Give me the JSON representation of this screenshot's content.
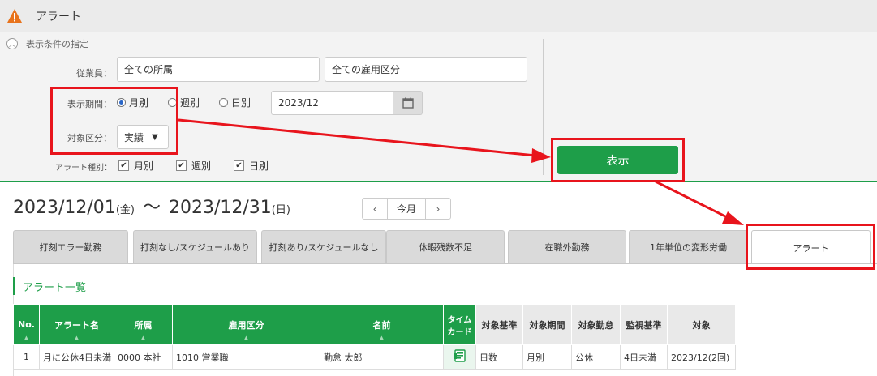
{
  "app": {
    "title": "アラート"
  },
  "conditions": {
    "header": "表示条件の指定",
    "employee_label": "従業員：",
    "department_value": "全ての所属",
    "employment_value": "全ての雇用区分",
    "period_label": "表示期間：",
    "period_options": [
      "月別",
      "週別",
      "日別"
    ],
    "period_selected": "月別",
    "month_value": "2023/12",
    "target_label": "対象区分：",
    "target_value": "実績",
    "alert_type_label": "アラート種別：",
    "alert_types": [
      "月別",
      "週別",
      "日別"
    ],
    "show_button": "表示"
  },
  "range": {
    "start": "2023/12/01",
    "start_dow": "(金)",
    "sep": "～",
    "end": "2023/12/31",
    "end_dow": "(日)",
    "today_label": "今月",
    "prev": "‹",
    "next": "›"
  },
  "tabs": [
    {
      "label": "打刻エラー勤務"
    },
    {
      "label": "打刻なし/スケジュールあり"
    },
    {
      "label": "打刻あり/スケジュールなし"
    },
    {
      "label": "休暇残数不足"
    },
    {
      "label": "在職外勤務"
    },
    {
      "label": "1年単位の変形労働"
    },
    {
      "label": "アラート"
    }
  ],
  "list": {
    "title": "アラート一覧",
    "headers": [
      "No.",
      "アラート名",
      "所属",
      "雇用区分",
      "名前",
      "タイム\nカード",
      "対象基準",
      "対象期間",
      "対象勤怠",
      "監視基準",
      "対象"
    ],
    "rows": [
      [
        "1",
        "月に公休4日未満",
        "0000 本社",
        "1010 営業職",
        "勤怠 太郎",
        "",
        "日数",
        "月別",
        "公休",
        "4日未満",
        "2023/12(2回)"
      ]
    ]
  },
  "colors": {
    "accent": "#1e9e49",
    "highlight": "#e8141c"
  }
}
